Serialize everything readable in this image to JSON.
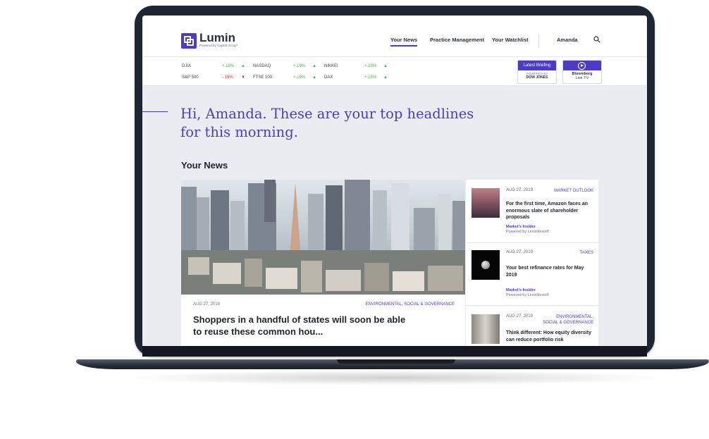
{
  "brand": {
    "name": "Lumin",
    "tagline": "Powered by Capital Group*"
  },
  "nav": {
    "items": [
      {
        "label": "Your News",
        "active": true
      },
      {
        "label": "Practice Management",
        "active": false
      },
      {
        "label": "Your Watchlist",
        "active": false
      }
    ],
    "user": "Amanda",
    "icons": {
      "search": "search-icon"
    }
  },
  "ticker": [
    {
      "name": "DJIA",
      "change": "+.19%",
      "direction": "up"
    },
    {
      "name": "NASDAQ",
      "change": "+.19%",
      "direction": "up"
    },
    {
      "name": "NIKKEI",
      "change": "+.19%",
      "direction": "up"
    },
    {
      "name": "S&P 500",
      "change": "-.19%",
      "direction": "down"
    },
    {
      "name": "FTSE 100",
      "change": "+.19%",
      "direction": "up"
    },
    {
      "name": "DAX",
      "change": "+.19%",
      "direction": "up"
    }
  ],
  "briefing": {
    "label": "Latest Briefing",
    "powered": "POWERED BY",
    "provider": "DOW JONES"
  },
  "bloomberg": {
    "name": "Bloomberg",
    "sub": "Live TV",
    "icon": "play-icon"
  },
  "greeting": "Hi, Amanda. These are your top headlines for this morning.",
  "section_title": "Your News",
  "featured": {
    "date": "AUG 27, 2019",
    "category": "ENVIRONMENTAL, SOCIAL & GOVERNANCE",
    "headline": "Shoppers in a handful of states will soon be able to reuse these common hou..."
  },
  "side_articles": [
    {
      "date": "AUG 27, 2019",
      "category": "MARKET OUTLOOK",
      "headline": "For the first time, Amazon faces an enormous slate of shareholder proposals",
      "source": "Market's Insider",
      "powered": "Powered by LexisNexis®"
    },
    {
      "date": "AUG 27, 2019",
      "category": "TAXES",
      "headline": "Your best refinance rates for May 2019",
      "source": "Market's Insider",
      "powered": "Powered by LexisNexis®"
    },
    {
      "date": "AUG 27, 2019",
      "category_line1": "ENVIRONMENTAL,",
      "category_line2": "SOCIAL & GOVERNANCE",
      "headline": "Think different: How equity diversity can reduce portfolio risk"
    }
  ],
  "colors": {
    "accent": "#4a3cc4",
    "up": "#4ab34a",
    "down": "#d22c2c",
    "laptop": "#202533"
  }
}
